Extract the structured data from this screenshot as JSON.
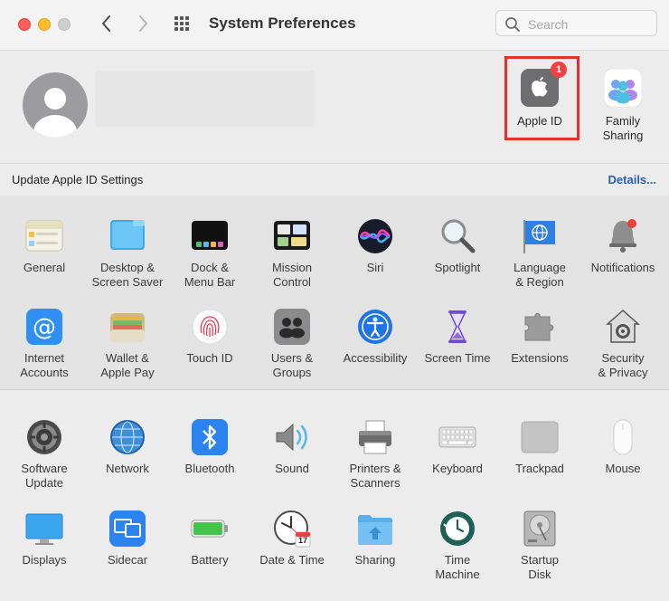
{
  "window": {
    "title": "System Preferences"
  },
  "search": {
    "placeholder": "Search"
  },
  "account": {
    "apple_id": {
      "label": "Apple ID",
      "badge": "1"
    },
    "family": {
      "label": "Family\nSharing"
    }
  },
  "update_bar": {
    "text": "Update Apple ID Settings",
    "details": "Details..."
  },
  "row1": [
    {
      "label": "General",
      "icon": "general-icon"
    },
    {
      "label": "Desktop &\nScreen Saver",
      "icon": "desktop-icon"
    },
    {
      "label": "Dock &\nMenu Bar",
      "icon": "dock-icon"
    },
    {
      "label": "Mission\nControl",
      "icon": "mission-control-icon"
    },
    {
      "label": "Siri",
      "icon": "siri-icon"
    },
    {
      "label": "Spotlight",
      "icon": "spotlight-icon"
    },
    {
      "label": "Language\n& Region",
      "icon": "language-icon"
    },
    {
      "label": "Notifications",
      "icon": "notifications-icon"
    }
  ],
  "row2": [
    {
      "label": "Internet\nAccounts",
      "icon": "at-icon"
    },
    {
      "label": "Wallet &\nApple Pay",
      "icon": "wallet-icon"
    },
    {
      "label": "Touch ID",
      "icon": "fingerprint-icon"
    },
    {
      "label": "Users &\nGroups",
      "icon": "users-icon"
    },
    {
      "label": "Accessibility",
      "icon": "accessibility-icon"
    },
    {
      "label": "Screen Time",
      "icon": "hourglass-icon"
    },
    {
      "label": "Extensions",
      "icon": "puzzle-icon"
    },
    {
      "label": "Security\n& Privacy",
      "icon": "security-icon"
    }
  ],
  "row3": [
    {
      "label": "Software\nUpdate",
      "icon": "gear-icon"
    },
    {
      "label": "Network",
      "icon": "globe-icon"
    },
    {
      "label": "Bluetooth",
      "icon": "bluetooth-icon"
    },
    {
      "label": "Sound",
      "icon": "speaker-icon"
    },
    {
      "label": "Printers &\nScanners",
      "icon": "printer-icon"
    },
    {
      "label": "Keyboard",
      "icon": "keyboard-icon"
    },
    {
      "label": "Trackpad",
      "icon": "trackpad-icon"
    },
    {
      "label": "Mouse",
      "icon": "mouse-icon"
    }
  ],
  "row4": [
    {
      "label": "Displays",
      "icon": "display-icon"
    },
    {
      "label": "Sidecar",
      "icon": "sidecar-icon"
    },
    {
      "label": "Battery",
      "icon": "battery-icon"
    },
    {
      "label": "Date & Time",
      "icon": "clock-icon"
    },
    {
      "label": "Sharing",
      "icon": "folder-icon"
    },
    {
      "label": "Time\nMachine",
      "icon": "time-machine-icon"
    },
    {
      "label": "Startup\nDisk",
      "icon": "disk-icon"
    }
  ],
  "clock_date": "17",
  "colors": {
    "accent": "#2460b5",
    "highlight": "#e5302a",
    "badge": "#ed4240"
  }
}
